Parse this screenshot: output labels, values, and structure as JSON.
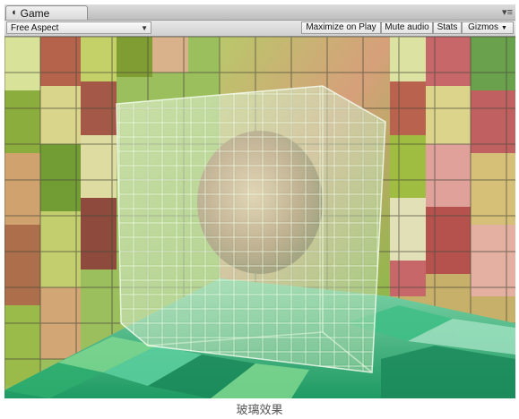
{
  "window": {
    "tab_title": "Game",
    "tab_icon": "pacman-game-icon",
    "menu_icon": "panel-menu-icon"
  },
  "toolbar": {
    "aspect_label": "Free Aspect",
    "maximize_label": "Maximize on Play",
    "mute_label": "Mute audio",
    "stats_label": "Stats",
    "gizmos_label": "Gizmos"
  },
  "scene": {
    "description_colors": {
      "wall_tiles": [
        "#7c9a2e",
        "#c9d46a",
        "#b85a4a",
        "#e0b090",
        "#5fa04a",
        "#d8c27a",
        "#9bbf3c",
        "#c8606a"
      ],
      "floor_tiles": [
        "#2fae6f",
        "#5dd0a0",
        "#1c8a5b",
        "#7fd890",
        "#3fbf86"
      ],
      "glass": "#cfe6c4",
      "sphere": "#c98a62"
    }
  },
  "caption": "玻璃效果"
}
